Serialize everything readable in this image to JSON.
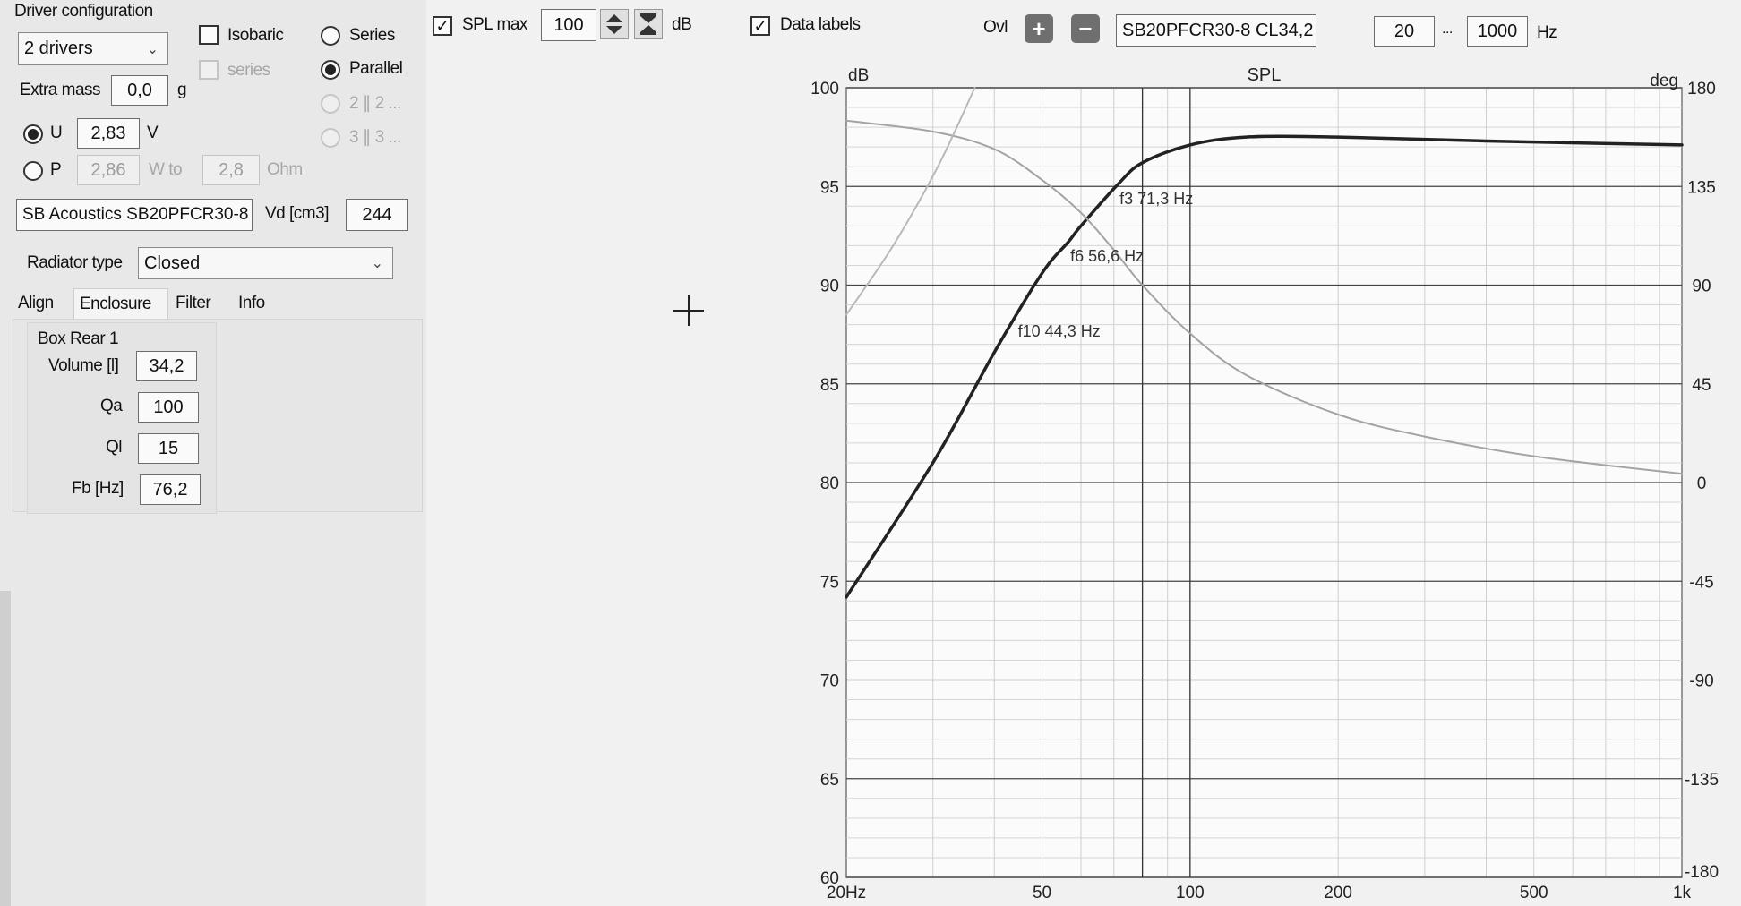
{
  "left": {
    "driver_config_title": "Driver configuration",
    "drivers_select": "2 drivers",
    "isobaric_label": "Isobaric",
    "isobaric_series_label": "series",
    "series_label": "Series",
    "parallel_label": "Parallel",
    "option_2x2": "2 ∥ 2 ...",
    "option_3x3": "3 ∥ 3 ...",
    "extra_mass_label": "Extra mass",
    "extra_mass_value": "0,0",
    "extra_mass_unit": "g",
    "u_label": "U",
    "u_value": "2,83",
    "u_unit": "V",
    "p_label": "P",
    "p_value": "2,86",
    "w_to_label": "W to",
    "ohm_value": "2,8",
    "ohm_unit": "Ohm",
    "driver_name": "SB Acoustics SB20PFCR30-8",
    "vd_label": "Vd [cm3]",
    "vd_value": "244",
    "radiator_type_label": "Radiator type",
    "radiator_type_value": "Closed",
    "tabs": [
      "Align",
      "Enclosure",
      "Filter",
      "Info"
    ],
    "box_title": "Box Rear 1",
    "fields": [
      {
        "label": "Volume [l]",
        "value": "34,2"
      },
      {
        "label": "Qa",
        "value": "100"
      },
      {
        "label": "Ql",
        "value": "15"
      },
      {
        "label": "Fb [Hz]",
        "value": "76,2"
      }
    ]
  },
  "toolbar": {
    "spl_max_label": "SPL max",
    "spl_max_value": "100",
    "db_unit": "dB",
    "data_labels_label": "Data labels",
    "ovl_label": "Ovl",
    "overlay_name": "SB20PFCR30-8 CL34,2",
    "freq_min": "20",
    "freq_sep": "...",
    "freq_max": "1000",
    "hz_unit": "Hz"
  },
  "chart_data": {
    "type": "line",
    "title": "SPL",
    "left_unit": "dB",
    "right_unit": "deg",
    "x_scale": "log",
    "xlim": [
      20,
      1000
    ],
    "ylim": [
      60,
      100
    ],
    "y2lim": [
      -180,
      180
    ],
    "x_tick_labels": [
      "20Hz",
      "50",
      "100",
      "200",
      "500",
      "1k"
    ],
    "y_ticks": [
      100,
      95,
      90,
      85,
      80,
      75,
      70,
      65,
      60
    ],
    "y2_ticks": [
      180,
      135,
      90,
      45,
      0,
      -45,
      -90,
      -135,
      -180
    ],
    "grid": true,
    "series": [
      {
        "kind": "spl",
        "color": "#222222",
        "points": [
          [
            20,
            74.2
          ],
          [
            30,
            81.0
          ],
          [
            40,
            86.6
          ],
          [
            50,
            90.6
          ],
          [
            56.6,
            92.2
          ],
          [
            60,
            93.0
          ],
          [
            71.3,
            95.1
          ],
          [
            80,
            96.2
          ],
          [
            100,
            97.1
          ],
          [
            130,
            97.5
          ],
          [
            200,
            97.5
          ],
          [
            400,
            97.3
          ],
          [
            1000,
            97.1
          ]
        ]
      },
      {
        "kind": "phase",
        "color": "#a3a3a3",
        "points": [
          [
            20,
            165
          ],
          [
            30,
            160
          ],
          [
            40,
            152
          ],
          [
            50,
            138
          ],
          [
            60,
            123
          ],
          [
            70,
            106
          ],
          [
            80,
            90
          ],
          [
            100,
            68
          ],
          [
            130,
            49
          ],
          [
            200,
            31
          ],
          [
            300,
            21
          ],
          [
            500,
            12
          ],
          [
            1000,
            4
          ]
        ]
      },
      {
        "kind": "excursion",
        "color": "#b8b8b8",
        "points": [
          [
            20,
            88.5
          ],
          [
            24.9,
            92.0
          ],
          [
            30.7,
            96.0
          ],
          [
            36.5,
            100
          ]
        ]
      }
    ],
    "vertical_markers": [
      100,
      80
    ],
    "annotations": [
      {
        "text": "f3 71,3 Hz",
        "x": 71.3,
        "y": 95.1
      },
      {
        "text": "f6 56,6 Hz",
        "x": 56.6,
        "y": 92.2
      },
      {
        "text": "f10 44,3 Hz",
        "x": 44.3,
        "y": 88.4
      }
    ]
  }
}
